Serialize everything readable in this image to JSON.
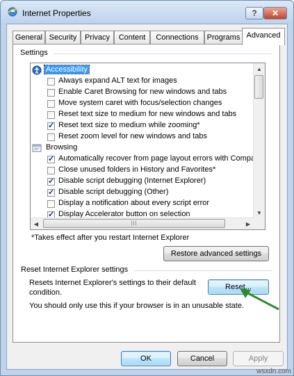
{
  "window": {
    "title": "Internet Properties"
  },
  "titlebar": {
    "help_label": "?",
    "close_label": "✕"
  },
  "tabs": [
    {
      "label": "General"
    },
    {
      "label": "Security"
    },
    {
      "label": "Privacy"
    },
    {
      "label": "Content"
    },
    {
      "label": "Connections"
    },
    {
      "label": "Programs"
    },
    {
      "label": "Advanced",
      "active": true
    }
  ],
  "settings": {
    "label": "Settings",
    "rows": [
      {
        "type": "category",
        "label": "Accessibility",
        "selected": true,
        "icon": "accessibility-icon"
      },
      {
        "type": "option",
        "label": "Always expand ALT text for images",
        "checked": false
      },
      {
        "type": "option",
        "label": "Enable Caret Browsing for new windows and tabs",
        "checked": false
      },
      {
        "type": "option",
        "label": "Move system caret with focus/selection changes",
        "checked": false
      },
      {
        "type": "option",
        "label": "Reset text size to medium for new windows and tabs",
        "checked": false
      },
      {
        "type": "option",
        "label": "Reset text size to medium while zooming*",
        "checked": true
      },
      {
        "type": "option",
        "label": "Reset zoom level for new windows and tabs",
        "checked": false
      },
      {
        "type": "category",
        "label": "Browsing",
        "selected": false,
        "icon": "browsing-icon"
      },
      {
        "type": "option",
        "label": "Automatically recover from page layout errors with Compa",
        "checked": true
      },
      {
        "type": "option",
        "label": "Close unused folders in History and Favorites*",
        "checked": false
      },
      {
        "type": "option",
        "label": "Disable script debugging (Internet Explorer)",
        "checked": true
      },
      {
        "type": "option",
        "label": "Disable script debugging (Other)",
        "checked": true
      },
      {
        "type": "option",
        "label": "Display a notification about every script error",
        "checked": false
      },
      {
        "type": "option",
        "label": "Display Accelerator button on selection",
        "checked": true
      }
    ],
    "footnote": "*Takes effect after you restart Internet Explorer",
    "restore_button": "Restore advanced settings"
  },
  "reset_section": {
    "heading": "Reset Internet Explorer settings",
    "desc_line1": "Resets Internet Explorer's settings to their default",
    "desc_line2": "condition.",
    "reset_button": "Reset...",
    "warning": "You should only use this if your browser is in an unusable state."
  },
  "footer": {
    "ok": "OK",
    "cancel": "Cancel",
    "apply": "Apply",
    "watermark": "wsxdn.com"
  },
  "colors": {
    "selection": "#3399ff",
    "arrow": "#2e8b2e",
    "accent": "#3c7fb1"
  }
}
